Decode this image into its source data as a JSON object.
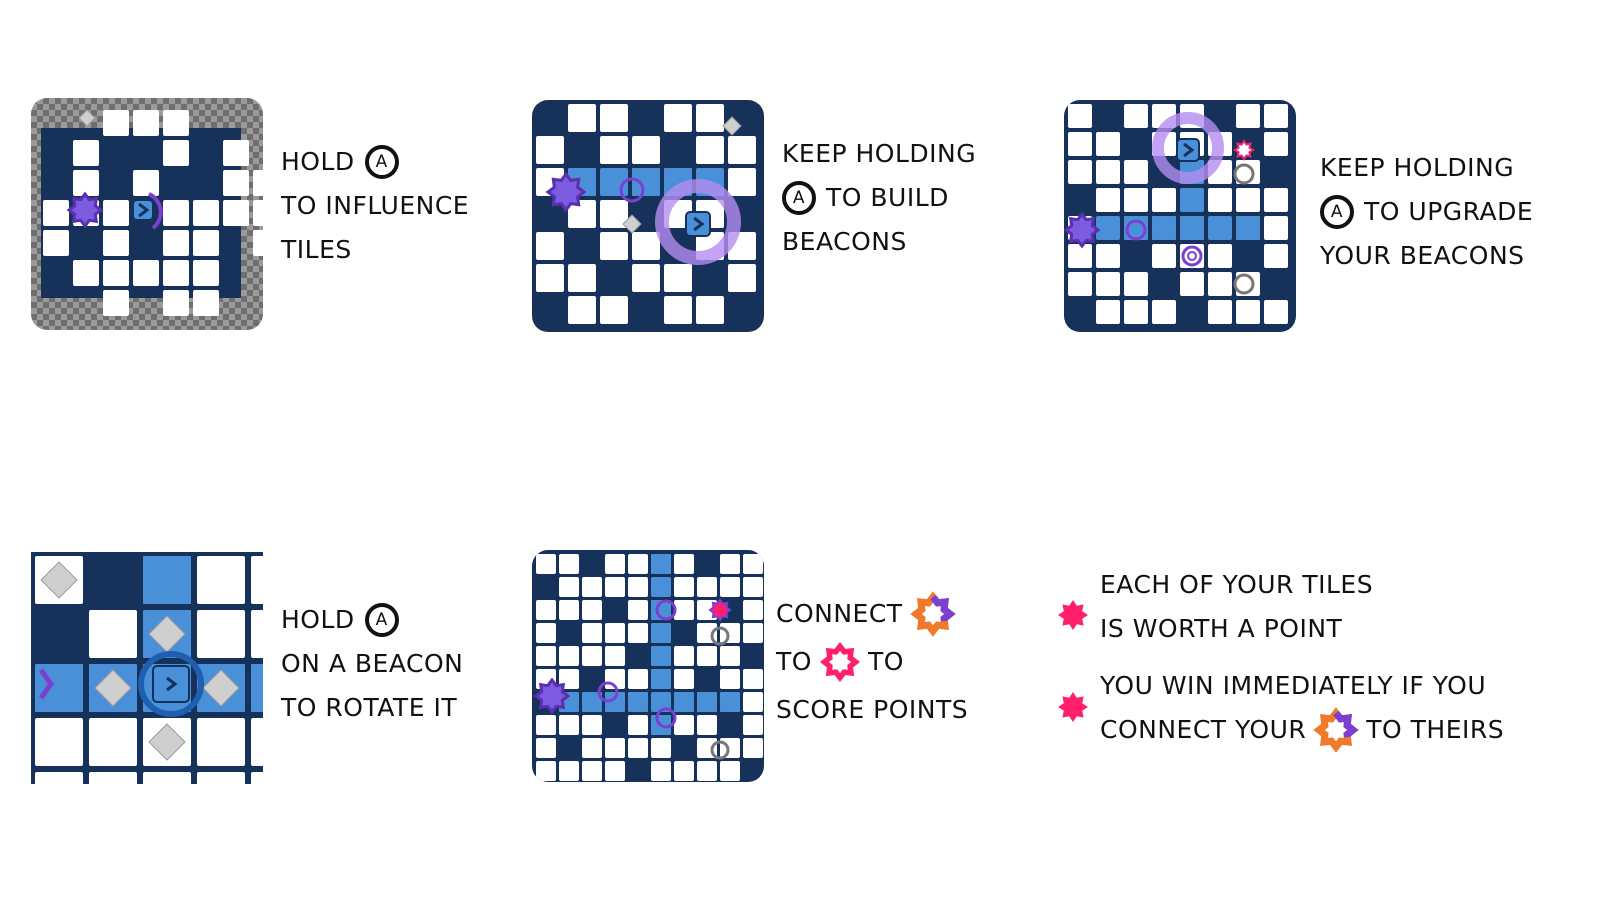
{
  "button_letter": "A",
  "colors": {
    "board_dark": "#16325a",
    "tile_white": "#ffffff",
    "tile_blue": "#4a90d9",
    "checker_grey": "#8a8a8a",
    "beacon_purple": "#7b3fd1",
    "base_orange": "#f07a2a",
    "enemy_pink": "#ff1f6a",
    "bullet_pink": "#ff1f6a"
  },
  "instructions": [
    {
      "lines": [
        [
          "HOLD",
          "{A}"
        ],
        [
          "TO INFLUENCE"
        ],
        [
          "TILES"
        ]
      ]
    },
    {
      "lines": [
        [
          "KEEP HOLDING"
        ],
        [
          "{A}",
          "TO BUILD"
        ],
        [
          "BEACONS"
        ]
      ]
    },
    {
      "lines": [
        [
          "KEEP HOLDING"
        ],
        [
          "{A}",
          "TO UPGRADE"
        ],
        [
          "YOUR BEACONS"
        ]
      ]
    },
    {
      "lines": [
        [
          "HOLD",
          "{A}"
        ],
        [
          "ON A BEACON"
        ],
        [
          "TO ROTATE IT"
        ]
      ]
    },
    {
      "lines": [
        [
          "CONNECT",
          "{base-icon}"
        ],
        [
          "TO",
          "{enemy-icon}",
          "TO"
        ],
        [
          "SCORE POINTS"
        ]
      ]
    }
  ],
  "rules": [
    {
      "lines": [
        [
          "EACH OF YOUR TILES"
        ],
        [
          "IS WORTH A POINT"
        ]
      ]
    },
    {
      "lines": [
        [
          "YOU WIN IMMEDIATELY IF YOU"
        ],
        [
          "CONNECT YOUR",
          "{base-icon}",
          "TO THEIRS"
        ]
      ]
    }
  ]
}
